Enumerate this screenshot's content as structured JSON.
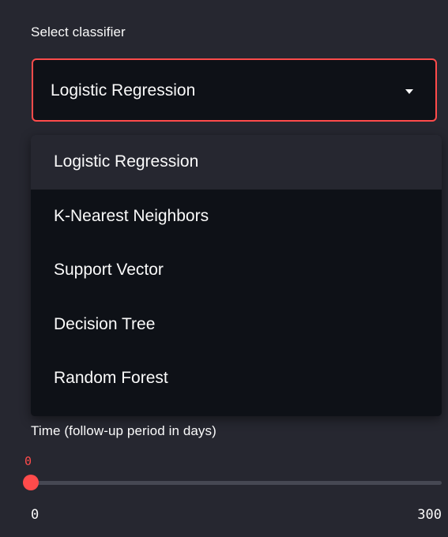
{
  "classifier_select": {
    "label": "Select classifier",
    "selected_value": "Logistic Regression",
    "options": [
      "Logistic Regression",
      "K-Nearest Neighbors",
      "Support Vector",
      "Decision Tree",
      "Random Forest"
    ],
    "highlighted_index": 0,
    "icon": "caret-down-icon"
  },
  "time_slider": {
    "label": "Time (follow-up period in days)",
    "value": "0",
    "min": "0",
    "max": "300",
    "fill_fraction": 0
  },
  "colors": {
    "background": "#262730",
    "accent": "#ff4b4b",
    "input_background": "#0e1117",
    "highlight": "#262730",
    "text": "#fafafa",
    "track": "#464853"
  }
}
